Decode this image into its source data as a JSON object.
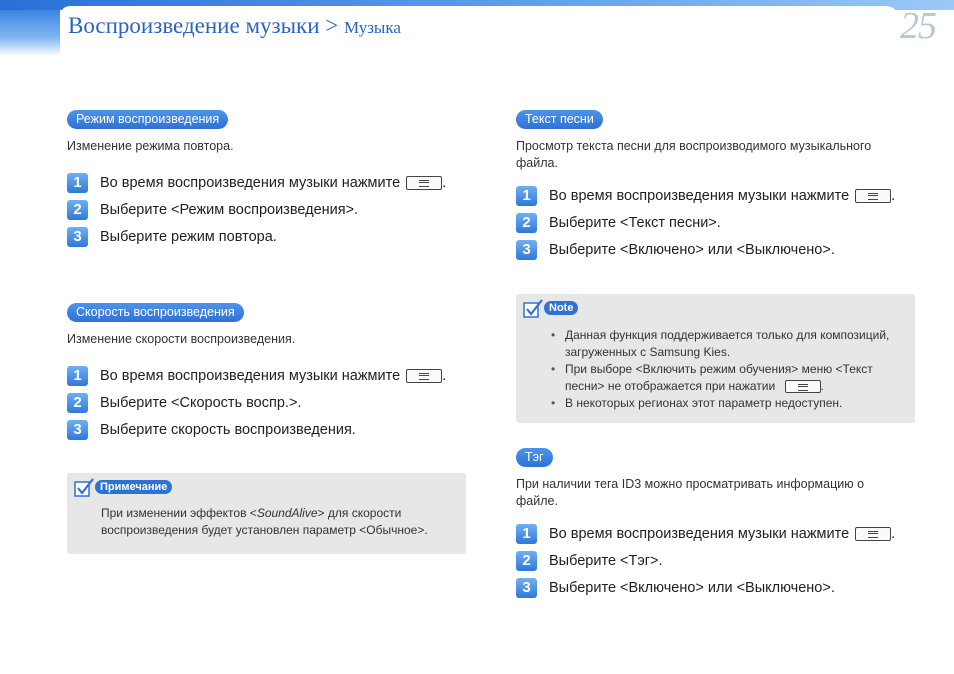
{
  "header": {
    "title": "Воспроизведение музыки >",
    "subtitle": "Музыка",
    "page_number": "25"
  },
  "left": {
    "section1": {
      "heading": "Режим воспроизведения",
      "description": "Изменение режима повтора.",
      "steps": [
        {
          "num": "1",
          "text": "Во время воспроизведения музыки нажмите",
          "after": "."
        },
        {
          "num": "2",
          "text": "Выберите <Режим воспроизведения>."
        },
        {
          "num": "3",
          "text": "Выберите режим повтора."
        }
      ]
    },
    "section2": {
      "heading": "Скорость воспроизведения",
      "description": "Изменение скорости воспроизведения.",
      "steps": [
        {
          "num": "1",
          "text": "Во время воспроизведения музыки нажмите",
          "after": "."
        },
        {
          "num": "2",
          "text": "Выберите <Скорость воспр.>."
        },
        {
          "num": "3",
          "text": "Выберите скорость воспроизведения."
        }
      ]
    },
    "note": {
      "label": "Примечание",
      "text_before": "При изменении эффектов <",
      "text_italic": "SoundAlive",
      "text_after": "> для скорости",
      "line2": "воспроизведения будет установлен параметр <Обычное>."
    }
  },
  "right": {
    "section1": {
      "heading": "Текст песни",
      "description_line1": "Просмотр текста песни для воспроизводимого музыкального",
      "description_line2": "файла.",
      "steps": [
        {
          "num": "1",
          "text": "Во время воспроизведения музыки нажмите",
          "after": "."
        },
        {
          "num": "2",
          "text": "Выберите <Текст песни>."
        },
        {
          "num": "3",
          "text": "Выберите <Включено> или <Выключено>."
        }
      ]
    },
    "note": {
      "label": "Note",
      "items": [
        {
          "l1": "Данная функция поддерживается только для композиций,",
          "l2": "загруженных с Samsung Kies."
        },
        {
          "l1": "При выборе <Включить режим обучения> меню <Текст",
          "l2": "песни> не отображается при нажатии",
          "after": "."
        },
        {
          "l1": "В некоторых регионах этот параметр недоступен."
        }
      ]
    },
    "section2": {
      "heading": "Тэг",
      "description_line1": "При наличии тега ID3 можно просматривать информацию о",
      "description_line2": "файле.",
      "steps": [
        {
          "num": "1",
          "text": "Во время воспроизведения музыки нажмите",
          "after": "."
        },
        {
          "num": "2",
          "text": "Выберите <Тэг>."
        },
        {
          "num": "3",
          "text": "Выберите <Включено> или <Выключено>."
        }
      ]
    }
  }
}
